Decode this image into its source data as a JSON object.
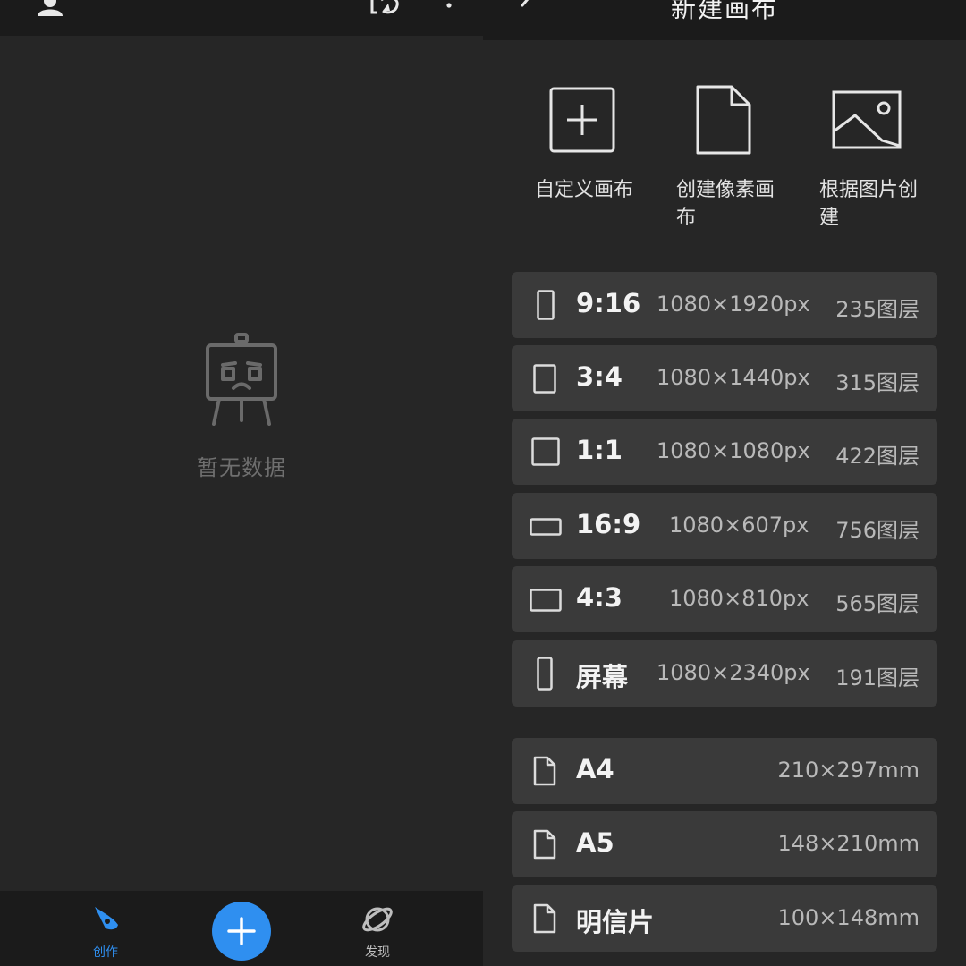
{
  "left": {
    "empty_text": "暂无数据",
    "nav": {
      "create_label": "创作",
      "discover_label": "发现"
    },
    "icons": [
      "user-icon",
      "sync-icon",
      "more-icon",
      "easel-icon",
      "brush-icon",
      "plus-icon",
      "planet-icon"
    ]
  },
  "right": {
    "title": "新建画布",
    "quick_actions": [
      {
        "label": "自定义画布",
        "icon": "add-square-icon"
      },
      {
        "label": "创建像素画布",
        "icon": "document-icon"
      },
      {
        "label": "根据图片创建",
        "icon": "image-icon"
      }
    ],
    "presets": [
      {
        "ratio": "9:16",
        "dims": "1080×1920px",
        "layers": "235图层"
      },
      {
        "ratio": "3:4",
        "dims": "1080×1440px",
        "layers": "315图层"
      },
      {
        "ratio": "1:1",
        "dims": "1080×1080px",
        "layers": "422图层"
      },
      {
        "ratio": "16:9",
        "dims": "1080×607px",
        "layers": "756图层"
      },
      {
        "ratio": "4:3",
        "dims": "1080×810px",
        "layers": "565图层"
      },
      {
        "ratio": "屏幕",
        "dims": "1080×2340px",
        "layers": "191图层"
      }
    ],
    "paper": [
      {
        "name": "A4",
        "size": "210×297mm"
      },
      {
        "name": "A5",
        "size": "148×210mm"
      },
      {
        "name": "明信片",
        "size": "100×148mm"
      }
    ]
  },
  "colors": {
    "accent": "#2f8ff0",
    "background": "#262626",
    "bar": "#1b1b1b",
    "card": "#3a3a3a"
  }
}
